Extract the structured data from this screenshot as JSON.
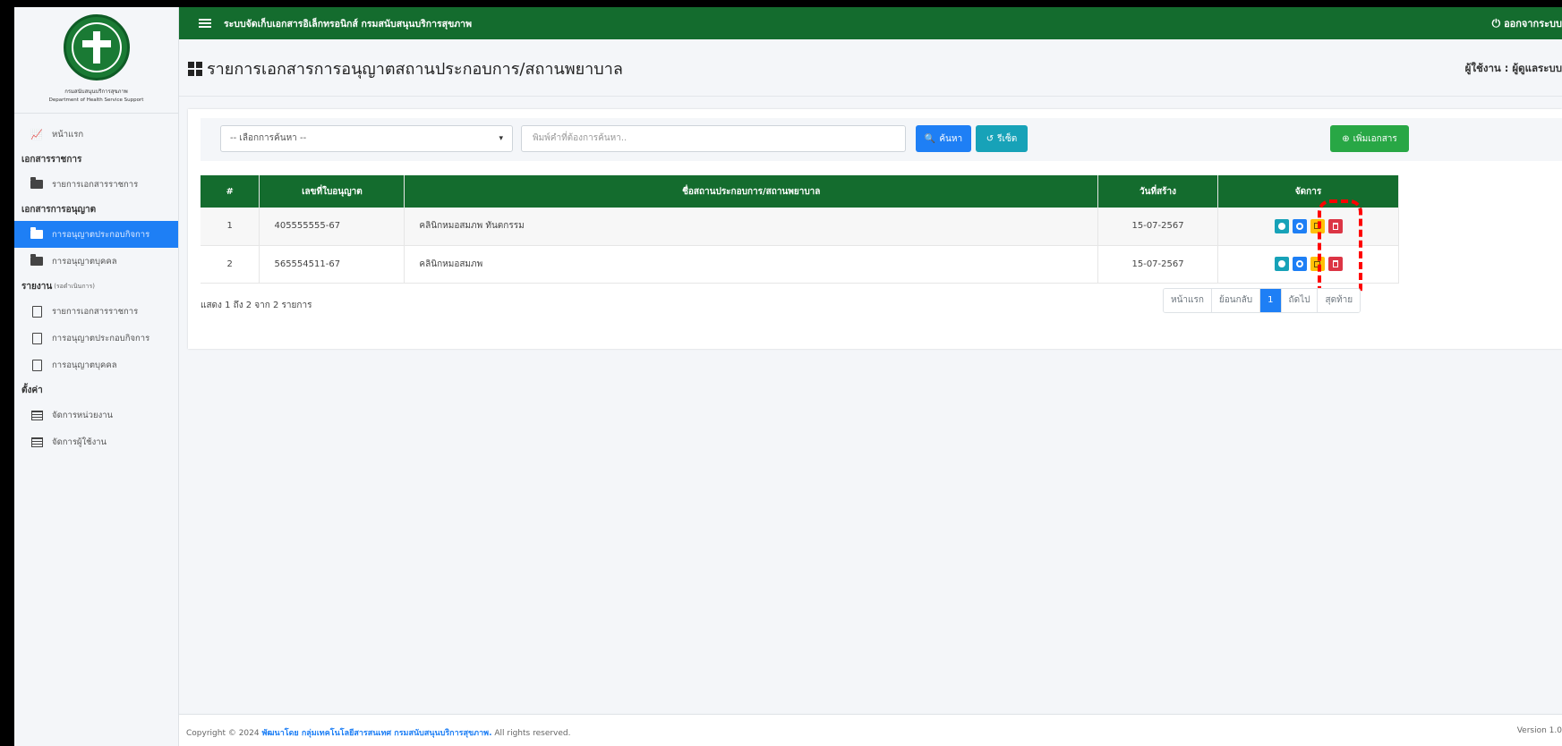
{
  "app": {
    "topbar_title": "ระบบจัดเก็บเอกสารอิเล็กทรอนิกส์ กรมสนับสนุนบริการสุขภาพ",
    "logout_label": "ออกจากระบบ"
  },
  "brand": {
    "name_th": "กรมสนับสนุนบริการสุขภาพ",
    "name_en": "Department of Health Service Support"
  },
  "sidebar": {
    "home": "หน้าแรก",
    "groups": [
      {
        "header": "เอกสารราชการ",
        "items": [
          "รายการเอกสารราชการ"
        ]
      },
      {
        "header": "เอกสารการอนุญาต",
        "items": [
          "การอนุญาตประกอบกิจการ",
          "การอนุญาตบุคคล"
        ]
      },
      {
        "header": "รายงาน",
        "header_sub": "(รอดำเนินการ)",
        "items": [
          "รายการเอกสารราชการ",
          "การอนุญาตประกอบกิจการ",
          "การอนุญาตบุคคล"
        ]
      },
      {
        "header": "ตั้งค่า",
        "items": [
          "จัดการหน่วยงาน",
          "จัดการผู้ใช้งาน"
        ]
      }
    ],
    "active_item": "การอนุญาตประกอบกิจการ"
  },
  "page": {
    "title": "รายการเอกสารการอนุญาตสถานประกอบการ/สถานพยาบาล",
    "user_label": "ผู้ใช้งาน : ผู้ดูแลระบบ"
  },
  "filters": {
    "select_value": "-- เลือกการค้นหา --",
    "search_placeholder": "พิมพ์คำที่ต้องการค้นหา..",
    "search_button": "ค้นหา",
    "reset_button": "รีเซ็ต",
    "add_button": "เพิ่มเอกสาร"
  },
  "table": {
    "headers": [
      "#",
      "เลขที่ใบอนุญาต",
      "ชื่อสถานประกอบการ/สถานพยาบาล",
      "วันที่สร้าง",
      "จัดการ"
    ],
    "rows": [
      {
        "no": "1",
        "license": "405555555-67",
        "name": "คลินิกหมอสมภพ ทันตกรรม",
        "created": "15-07-2567"
      },
      {
        "no": "2",
        "license": "565554511-67",
        "name": "คลินิกหมอสมภพ",
        "created": "15-07-2567"
      }
    ]
  },
  "pagination": {
    "summary": "แสดง 1 ถึง 2 จาก 2 รายการ",
    "first": "หน้าแรก",
    "prev": "ย้อนกลับ",
    "current": "1",
    "next": "ถัดไป",
    "last": "สุดท้าย"
  },
  "footer": {
    "prefix": "Copyright © 2024",
    "link": "พัฒนาโดย กลุ่มเทคโนโลยีสารสนเทศ กรมสนับสนุนบริการสุขภาพ.",
    "suffix": "All rights reserved.",
    "version": "Version 1.0"
  },
  "colors": {
    "primary_green": "#146c2e",
    "blue": "#1e7ff5",
    "info": "#17a2b8",
    "warning": "#ffc107",
    "danger": "#dc3545",
    "success": "#28a745",
    "highlight": "#ff0000"
  }
}
